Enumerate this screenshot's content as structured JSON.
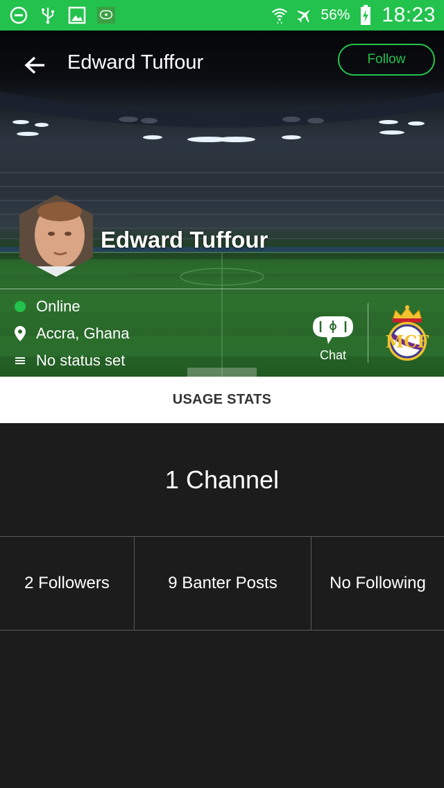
{
  "status_bar": {
    "battery_percent": "56%",
    "time": "18:23",
    "icons": [
      "do-not-disturb-icon",
      "usb-icon",
      "gallery-icon",
      "app-notification-icon",
      "wifi-icon",
      "airplane-icon",
      "battery-charging-icon"
    ]
  },
  "app_bar": {
    "title": "Edward Tuffour",
    "follow_label": "Follow"
  },
  "profile": {
    "name": "Edward Tuffour",
    "status_online": "Online",
    "location": "Accra, Ghana",
    "status_text": "No status set",
    "chat_label": "Chat",
    "club_crest": "real-madrid-crest"
  },
  "usage": {
    "header": "USAGE STATS",
    "channels": "1 Channel",
    "followers": "2 Followers",
    "banter_posts": "9 Banter Posts",
    "following": "No Following"
  },
  "colors": {
    "accent": "#22c24d",
    "background": "#1c1c1c",
    "header_bg": "#ffffff"
  }
}
